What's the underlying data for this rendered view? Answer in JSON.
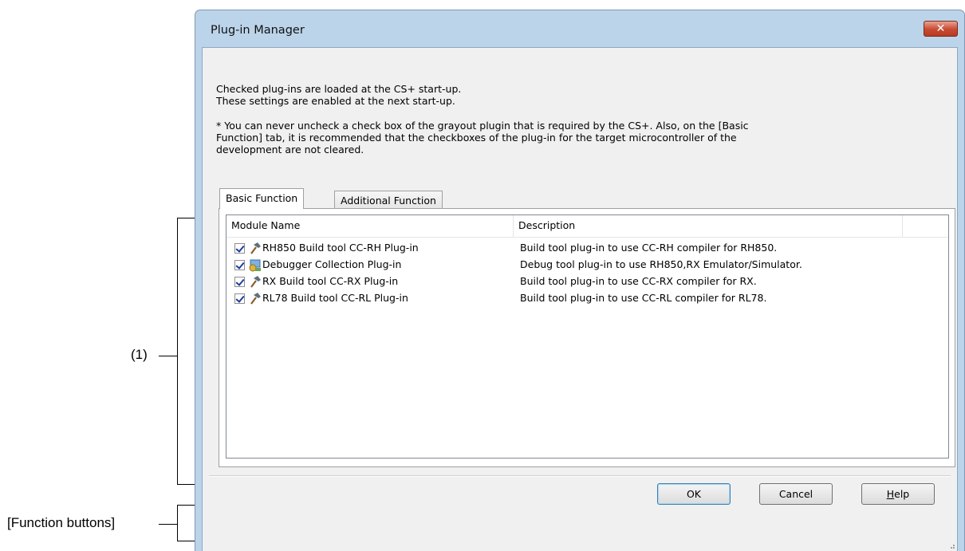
{
  "annotations": {
    "list_label": "(1)",
    "buttons_label": "[Function buttons]"
  },
  "dialog": {
    "title": "Plug-in Manager",
    "close_glyph": "✕",
    "info_line1": "Checked plug-ins are loaded at the CS+ start-up.",
    "info_line2": "These settings are enabled at the next start-up.",
    "note_line1": "* You can never uncheck a check box of the grayout plugin that is required by the CS+. Also, on the [Basic",
    "note_line2": "Function] tab, it is recommended that the checkboxes of the plug-in for the target microcontroller of the",
    "note_line3": "development are not cleared.",
    "tabs": [
      {
        "label": "Basic Function",
        "active": true
      },
      {
        "label": "Additional Function",
        "active": false
      }
    ],
    "columns": [
      "Module Name",
      "Description"
    ],
    "rows": [
      {
        "checked": true,
        "icon": "hammer-icon",
        "name": "RH850 Build tool CC-RH Plug-in",
        "description": "Build tool plug-in to use CC-RH compiler for RH850."
      },
      {
        "checked": true,
        "icon": "debugger-icon",
        "name": "Debugger Collection Plug-in",
        "description": "Debug tool plug-in to use RH850,RX Emulator/Simulator."
      },
      {
        "checked": true,
        "icon": "hammer-icon",
        "name": "RX Build tool CC-RX Plug-in",
        "description": "Build tool plug-in to use CC-RX compiler for RX."
      },
      {
        "checked": true,
        "icon": "hammer-icon",
        "name": "RL78 Build tool CC-RL Plug-in",
        "description": "Build tool plug-in to use CC-RL compiler for RL78."
      }
    ],
    "buttons": {
      "ok": "OK",
      "cancel": "Cancel",
      "help_prefix": "H",
      "help_rest": "elp"
    }
  },
  "colors": {
    "frame": "#bcd4ea",
    "close": "#c84a33",
    "client": "#f0f0f0"
  }
}
